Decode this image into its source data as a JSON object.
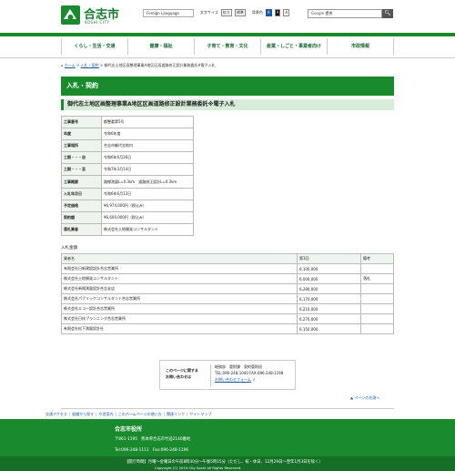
{
  "header": {
    "site_name": "合志市",
    "site_sub": "KOSHI CITY",
    "language_button": "Foreign Language",
    "text_size_label": "文字サイズ",
    "text_size_enlarge": "拡大",
    "text_size_standard": "標準",
    "contrast_label": "背景色",
    "contrast_options": [
      "A",
      "A",
      "A"
    ],
    "search_brand": "Google",
    "search_placeholder": "提供",
    "search_button_icon": "search-icon"
  },
  "nav": {
    "items": [
      "くらし・生活・交通",
      "健康・福祉",
      "子育て・教育・文化",
      "産業・しごと・事業者向け",
      "市政情報"
    ]
  },
  "breadcrumb": {
    "home": "ホーム",
    "level1": "入札・契約",
    "current": "御代志土地区画整理事業A地区区画道路修正設計業務委託※電子入札"
  },
  "section_title": "入札・契約",
  "page_title": "御代志土地区画整理事業A地区区画道路修正設計業務委託※電子入札",
  "info_table": [
    {
      "k": "工事番号",
      "v": "都整委第5号"
    },
    {
      "k": "年度",
      "v": "令和6年度"
    },
    {
      "k": "工事場所",
      "v": "合志市御代志地内"
    },
    {
      "k": "工期・・・自",
      "v": "令和6年6月26日"
    },
    {
      "k": "工期・・・至",
      "v": "令和7年3月14日"
    },
    {
      "k": "工事概要",
      "v": "路線測量L=0.3km　道路修正設計L=0.3km"
    },
    {
      "k": "入札年月日",
      "v": "令和6年6月13日"
    },
    {
      "k": "予定価格",
      "v": "¥6,974,000円（税込み）"
    },
    {
      "k": "契約額",
      "v": "¥6,600,000円（税込み）"
    },
    {
      "k": "落札業者",
      "v": "株式会社土地開発コンサルタント"
    }
  ],
  "bid_label": "入札金額",
  "bid_table": {
    "headers": [
      "業者名",
      "第1回",
      "備考"
    ],
    "rows": [
      [
        "有限会社日新建設設計合志営業所",
        "6,100,000",
        ""
      ],
      [
        "株式会社土地開発コンサルタント",
        "6,000,000",
        "落札"
      ],
      [
        "株式会社新興測量設計合志支店",
        "6,280,000",
        ""
      ],
      [
        "株式会社パブリックコンサルタント合志営業所",
        "6,170,000",
        ""
      ],
      [
        "株式会社エコー設計合志営業所",
        "6,210,000",
        ""
      ],
      [
        "株式会社日技プランニング合志営業所",
        "6,270,000",
        ""
      ],
      [
        "有限会社松下測量設計社",
        "6,150,000",
        ""
      ]
    ]
  },
  "contact": {
    "title_line1": "このページに関する",
    "title_line2": "お問い合わせは",
    "dept": "総務部　管財課　契約管財班",
    "tel": "TEL:096-248-1040 FAX:096-248-1198",
    "form_link": "お問い合わせフォーム"
  },
  "page_top": "ページの先頭へ",
  "footer_links": [
    "交通アクセス",
    "組織から探す",
    "庁舎案内",
    "このホームページの使い方",
    "関連リンク",
    "サイトマップ"
  ],
  "footer": {
    "name": "合志市役所",
    "address": "〒861-1195　熊本県合志市竹迫2140番地",
    "tel": "Tel:096-248-1111　Fax:096-248-1196",
    "hours": "【開庁時間】月曜～金曜日の午前8時30分～午後5時15分（ただし、祝・休日、12月29日～翌年1月3日を除く）",
    "copyright": "Copyright (C) 2019 City Koshi All Rights Reserved."
  },
  "colors": {
    "brand_green": "#1a8a2e",
    "link_blue": "#1a5aa0",
    "table_header": "#eef5ee"
  }
}
